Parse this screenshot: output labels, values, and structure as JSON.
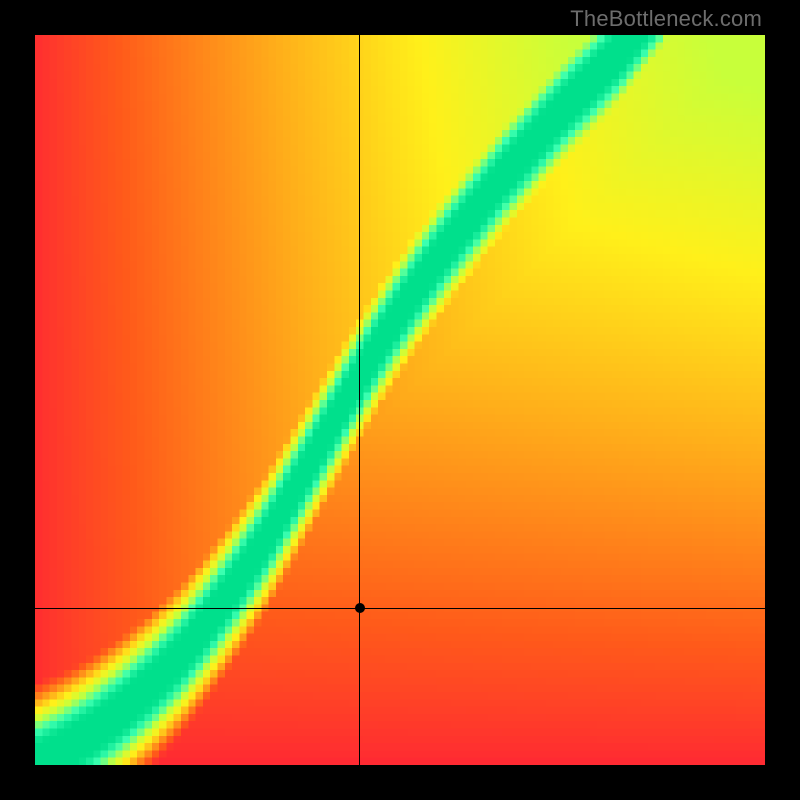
{
  "watermark": "TheBottleneck.com",
  "chart_data": {
    "type": "heatmap",
    "title": "",
    "xlabel": "",
    "ylabel": "",
    "xlim": [
      0,
      1
    ],
    "ylim": [
      0,
      1
    ],
    "grid_size": 100,
    "colorscale": {
      "stops": [
        {
          "t": 0.0,
          "color": "#ff1a3a"
        },
        {
          "t": 0.18,
          "color": "#ff5a1a"
        },
        {
          "t": 0.38,
          "color": "#ffae1a"
        },
        {
          "t": 0.55,
          "color": "#fff01a"
        },
        {
          "t": 0.72,
          "color": "#c8ff3a"
        },
        {
          "t": 0.9,
          "color": "#3affb0"
        },
        {
          "t": 1.0,
          "color": "#00e08c"
        }
      ]
    },
    "optimal_curve": [
      {
        "x": 0.0,
        "y": 0.0
      },
      {
        "x": 0.04,
        "y": 0.02
      },
      {
        "x": 0.08,
        "y": 0.045
      },
      {
        "x": 0.12,
        "y": 0.075
      },
      {
        "x": 0.16,
        "y": 0.11
      },
      {
        "x": 0.2,
        "y": 0.15
      },
      {
        "x": 0.24,
        "y": 0.2
      },
      {
        "x": 0.28,
        "y": 0.255
      },
      {
        "x": 0.32,
        "y": 0.315
      },
      {
        "x": 0.36,
        "y": 0.385
      },
      {
        "x": 0.4,
        "y": 0.455
      },
      {
        "x": 0.44,
        "y": 0.525
      },
      {
        "x": 0.48,
        "y": 0.59
      },
      {
        "x": 0.52,
        "y": 0.65
      },
      {
        "x": 0.56,
        "y": 0.705
      },
      {
        "x": 0.6,
        "y": 0.755
      },
      {
        "x": 0.64,
        "y": 0.805
      },
      {
        "x": 0.68,
        "y": 0.85
      },
      {
        "x": 0.72,
        "y": 0.895
      },
      {
        "x": 0.76,
        "y": 0.935
      },
      {
        "x": 0.8,
        "y": 0.975
      },
      {
        "x": 0.82,
        "y": 1.0
      }
    ],
    "band_half_width": 0.04,
    "crosshair": {
      "x": 0.445,
      "y": 0.215
    },
    "marker": {
      "x": 0.445,
      "y": 0.215
    }
  }
}
